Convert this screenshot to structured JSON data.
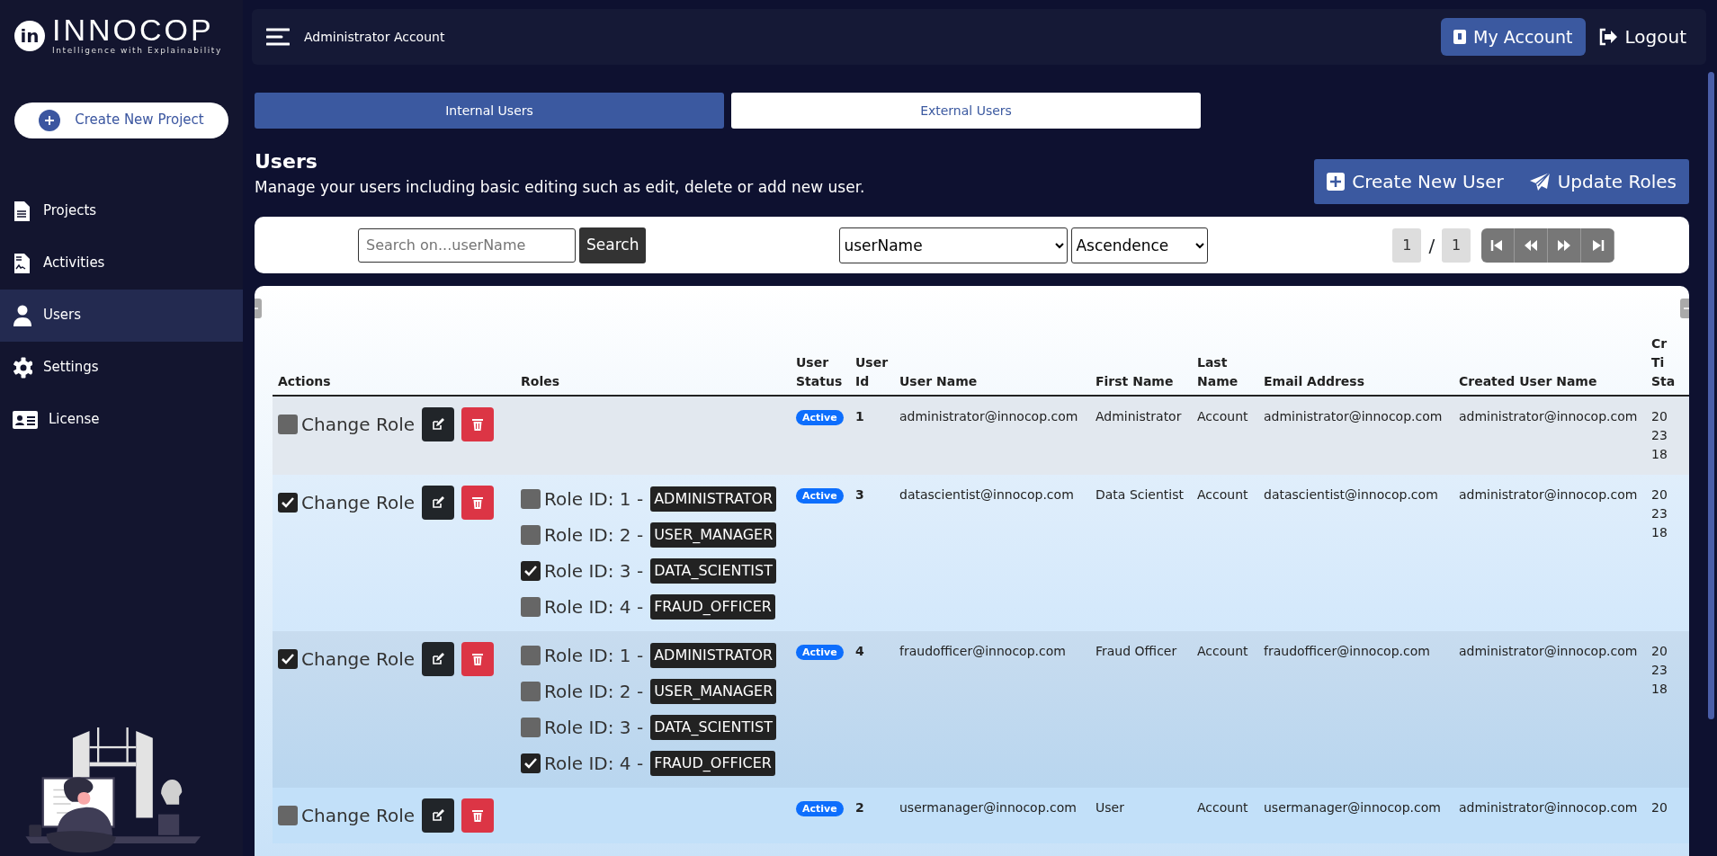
{
  "brand": {
    "mark": "in",
    "name": "INNOCOP",
    "tagline": "Intelligence with Explainability"
  },
  "sidebar": {
    "create_button": "Create New Project",
    "items": [
      {
        "label": "Projects",
        "kind": "document",
        "selected": false
      },
      {
        "label": "Activities",
        "kind": "activity",
        "selected": false
      },
      {
        "label": "Users",
        "kind": "user",
        "selected": true
      },
      {
        "label": "Settings",
        "kind": "gear",
        "selected": false
      },
      {
        "label": "License",
        "kind": "license",
        "selected": false
      }
    ]
  },
  "header": {
    "title": "Administrator Account",
    "account_button": "My Account",
    "logout": "Logout"
  },
  "tabs": [
    {
      "label": "Internal Users",
      "selected": true
    },
    {
      "label": "External Users",
      "selected": false
    }
  ],
  "page": {
    "title": "Users",
    "description": "Manage your users including basic editing such as edit, delete or add new user.",
    "actions": [
      {
        "label": "Create New User",
        "kind": "plus"
      },
      {
        "label": "Update Roles",
        "kind": "send"
      }
    ]
  },
  "filter": {
    "search_placeholder": "Search on...userName",
    "search_button": "Search",
    "sort_field": "userName",
    "sort_order": "Ascendence",
    "page": "1",
    "separator": "/",
    "pages": "1"
  },
  "table": {
    "columns": [
      "Actions",
      "Roles",
      "User Status",
      "User Id",
      "User Name",
      "First Name",
      "Last Name",
      "Email Address",
      "Created User Name",
      "Cr\nTi\nSta"
    ],
    "rows": [
      {
        "checked": false,
        "action": "Change Role",
        "status": "Active",
        "id": "1",
        "user_name": "administrator@innocop.com",
        "first_name": "Administrator",
        "last_name": "Account",
        "email": "administrator@innocop.com",
        "created_by": "administrator@innocop.com",
        "column_10": "20\n23\n18"
      },
      {
        "checked": true,
        "action": "Change Role",
        "roles": [
          {
            "label": "Role ID: 1 -",
            "name": "ADMINISTRATOR",
            "checked": false
          },
          {
            "label": "Role ID: 2 -",
            "name": "USER_MANAGER",
            "checked": false
          },
          {
            "label": "Role ID: 3 -",
            "name": "DATA_SCIENTIST",
            "checked": true
          },
          {
            "label": "Role ID: 4 -",
            "name": "FRAUD_OFFICER",
            "checked": false
          }
        ],
        "status": "Active",
        "id": "3",
        "user_name": "datascientist@innocop.com",
        "first_name": "Data Scientist",
        "last_name": "Account",
        "email": "datascientist@innocop.com",
        "created_by": "administrator@innocop.com",
        "column_10": "20\n23\n18"
      },
      {
        "checked": true,
        "action": "Change Role",
        "roles": [
          {
            "label": "Role ID: 1 -",
            "name": "ADMINISTRATOR",
            "checked": false
          },
          {
            "label": "Role ID: 2 -",
            "name": "USER_MANAGER",
            "checked": false
          },
          {
            "label": "Role ID: 3 -",
            "name": "DATA_SCIENTIST",
            "checked": false
          },
          {
            "label": "Role ID: 4 -",
            "name": "FRAUD_OFFICER",
            "checked": true
          }
        ],
        "status": "Active",
        "id": "4",
        "user_name": "fraudofficer@innocop.com",
        "first_name": "Fraud Officer",
        "last_name": "Account",
        "email": "fraudofficer@innocop.com",
        "created_by": "administrator@innocop.com",
        "column_10": "20\n23\n18"
      },
      {
        "checked": false,
        "action": "Change Role",
        "status": "Active",
        "id": "2",
        "user_name": "usermanager@innocop.com",
        "first_name": "User",
        "last_name": "Account",
        "email": "usermanager@innocop.com",
        "created_by": "administrator@innocop.com",
        "column_10": "20"
      }
    ]
  }
}
